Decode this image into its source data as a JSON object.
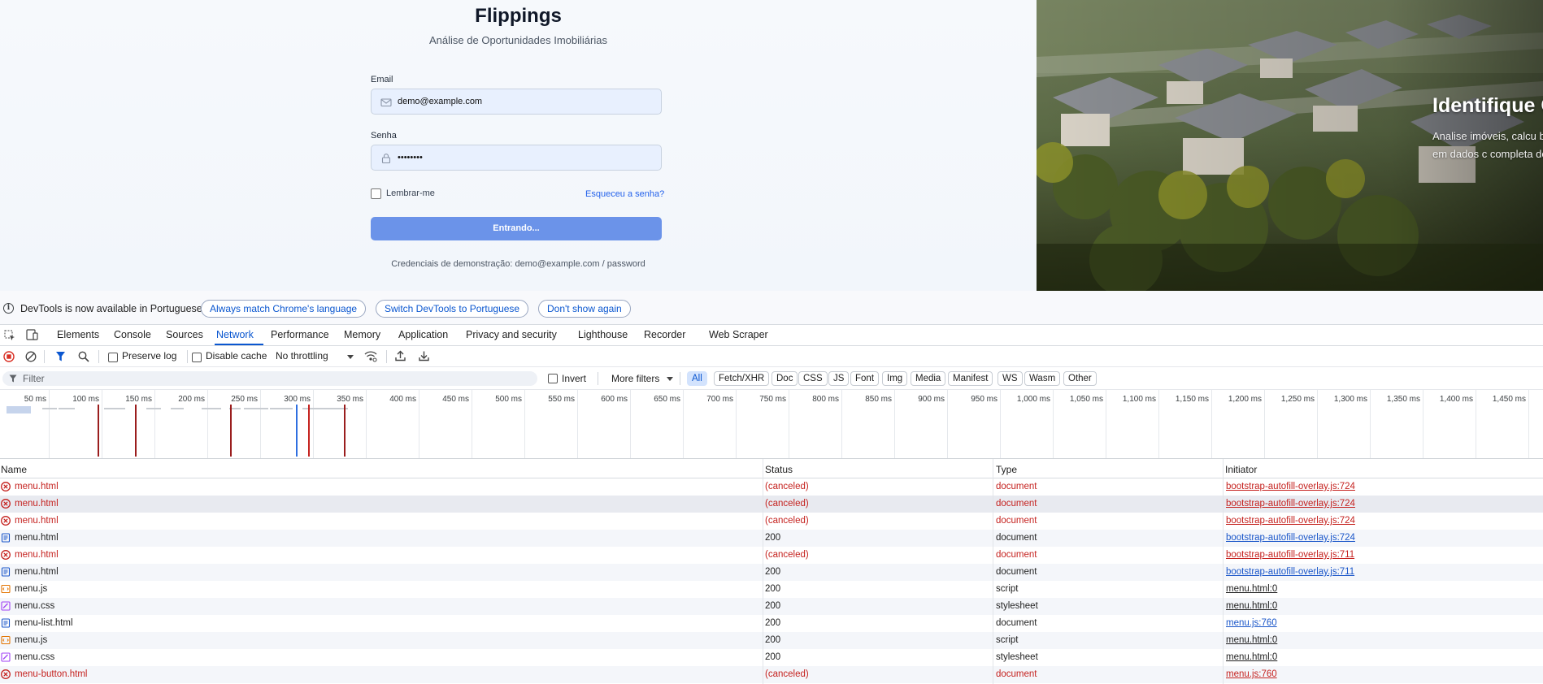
{
  "login": {
    "app_title": "Flippings",
    "subtitle": "Análise de Oportunidades Imobiliárias",
    "email_label": "Email",
    "email_value": "demo@example.com",
    "password_label": "Senha",
    "password_value": "••••••••",
    "remember_label": "Lembrar-me",
    "forgot_link": "Esqueceu a senha?",
    "submit_label": "Entrando...",
    "demo_credentials": "Credenciais de demonstração: demo@example.com / password"
  },
  "hero": {
    "title": "Identifique O",
    "text": "Analise imóveis, calcu baseadas em dados c completa de análise."
  },
  "devtools": {
    "infobar": {
      "message": "DevTools is now available in Portuguese!",
      "btn_match": "Always match Chrome's language",
      "btn_switch": "Switch DevTools to Portuguese",
      "btn_dismiss": "Don't show again"
    },
    "tabs": [
      "Elements",
      "Console",
      "Sources",
      "Network",
      "Performance",
      "Memory",
      "Application",
      "Privacy and security",
      "Lighthouse",
      "Recorder",
      "Web Scraper"
    ],
    "active_tab": "Network",
    "toolbar": {
      "preserve_log": "Preserve log",
      "disable_cache": "Disable cache",
      "throttling": "No throttling"
    },
    "filter": {
      "placeholder": "Filter",
      "invert": "Invert",
      "more_filters": "More filters",
      "types": [
        "All",
        "Fetch/XHR",
        "Doc",
        "CSS",
        "JS",
        "Font",
        "Img",
        "Media",
        "Manifest",
        "WS",
        "Wasm",
        "Other"
      ],
      "active_type": "All"
    },
    "timeline_ticks": [
      "50 ms",
      "100 ms",
      "150 ms",
      "200 ms",
      "250 ms",
      "300 ms",
      "350 ms",
      "400 ms",
      "450 ms",
      "500 ms",
      "550 ms",
      "600 ms",
      "650 ms",
      "700 ms",
      "750 ms",
      "800 ms",
      "850 ms",
      "900 ms",
      "950 ms",
      "1,000 ms",
      "1,050 ms",
      "1,100 ms",
      "1,150 ms",
      "1,200 ms",
      "1,250 ms",
      "1,300 ms",
      "1,350 ms",
      "1,400 ms",
      "1,450 ms"
    ],
    "columns": {
      "name": "Name",
      "status": "Status",
      "type": "Type",
      "initiator": "Initiator"
    },
    "requests": [
      {
        "name": "menu.html",
        "status": "(canceled)",
        "type": "document",
        "initiator": "bootstrap-autofill-overlay.js:724",
        "kind": "error"
      },
      {
        "name": "menu.html",
        "status": "(canceled)",
        "type": "document",
        "initiator": "bootstrap-autofill-overlay.js:724",
        "kind": "error"
      },
      {
        "name": "menu.html",
        "status": "(canceled)",
        "type": "document",
        "initiator": "bootstrap-autofill-overlay.js:724",
        "kind": "error"
      },
      {
        "name": "menu.html",
        "status": "200",
        "type": "document",
        "initiator": "bootstrap-autofill-overlay.js:724",
        "kind": "doc"
      },
      {
        "name": "menu.html",
        "status": "(canceled)",
        "type": "document",
        "initiator": "bootstrap-autofill-overlay.js:711",
        "kind": "error"
      },
      {
        "name": "menu.html",
        "status": "200",
        "type": "document",
        "initiator": "bootstrap-autofill-overlay.js:711",
        "kind": "doc"
      },
      {
        "name": "menu.js",
        "status": "200",
        "type": "script",
        "initiator": "menu.html:0",
        "kind": "script"
      },
      {
        "name": "menu.css",
        "status": "200",
        "type": "stylesheet",
        "initiator": "menu.html:0",
        "kind": "css"
      },
      {
        "name": "menu-list.html",
        "status": "200",
        "type": "document",
        "initiator": "menu.js:760",
        "kind": "doc"
      },
      {
        "name": "menu.js",
        "status": "200",
        "type": "script",
        "initiator": "menu.html:0",
        "kind": "script"
      },
      {
        "name": "menu.css",
        "status": "200",
        "type": "stylesheet",
        "initiator": "menu.html:0",
        "kind": "css"
      },
      {
        "name": "menu-button.html",
        "status": "(canceled)",
        "type": "document",
        "initiator": "menu.js:760",
        "kind": "error"
      }
    ]
  },
  "colors": {
    "error": "#c5221f",
    "accent": "#0b57d0",
    "button": "#6b93e9"
  }
}
